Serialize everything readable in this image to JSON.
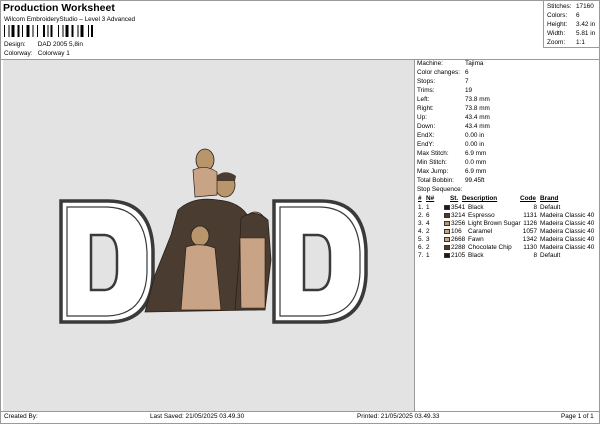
{
  "header": {
    "title": "Production Worksheet",
    "software": "Wilcom EmbroideryStudio – Level 3 Advanced",
    "design_label": "Design:",
    "design_value": "DAD 2005 5,8in",
    "colorway_label": "Colorway:",
    "colorway_value": "Colorway 1"
  },
  "stats": [
    {
      "label": "Stitches:",
      "value": "17160"
    },
    {
      "label": "Colors:",
      "value": "6"
    },
    {
      "label": "Height:",
      "value": "3.42 in"
    },
    {
      "label": "Width:",
      "value": "5.81 in"
    },
    {
      "label": "Zoom:",
      "value": "1:1"
    }
  ],
  "machine_info": [
    {
      "label": "Machine:",
      "value": "Tajima"
    },
    {
      "label": "Color changes:",
      "value": "6"
    },
    {
      "label": "Stops:",
      "value": "7"
    },
    {
      "label": "Trims:",
      "value": "19"
    },
    {
      "label": "Left:",
      "value": "73.8 mm"
    },
    {
      "label": "Right:",
      "value": "73.8 mm"
    },
    {
      "label": "Up:",
      "value": "43.4 mm"
    },
    {
      "label": "Down:",
      "value": "43.4 mm"
    },
    {
      "label": "EndX:",
      "value": "0.00 in"
    },
    {
      "label": "EndY:",
      "value": "0.00 in"
    },
    {
      "label": "Max Stitch:",
      "value": "6.9 mm"
    },
    {
      "label": "Min Stitch:",
      "value": "0.0 mm"
    },
    {
      "label": "Max Jump:",
      "value": "6.9 mm"
    },
    {
      "label": "Total Bobbin:",
      "value": "99.45ft"
    }
  ],
  "stop_sequence": {
    "heading": "Stop Sequence:",
    "columns": [
      "#",
      "N#",
      "St.",
      "Description",
      "Code",
      "Brand"
    ],
    "rows": [
      {
        "num": "1.",
        "needle": "1",
        "color": "#1a1a1a",
        "stitches": "3541",
        "description": "Black",
        "code": "8",
        "brand": "Default"
      },
      {
        "num": "2.",
        "needle": "6",
        "color": "#4a3a2e",
        "stitches": "3214",
        "description": "Espresso",
        "code": "1131",
        "brand": "Madeira Classic 40"
      },
      {
        "num": "3.",
        "needle": "4",
        "color": "#b8956a",
        "stitches": "3256",
        "description": "Light Brown Sugar",
        "code": "1126",
        "brand": "Madeira Classic 40"
      },
      {
        "num": "4.",
        "needle": "2",
        "color": "#c8a47a",
        "stitches": "106",
        "description": "Caramel",
        "code": "1057",
        "brand": "Madeira Classic 40"
      },
      {
        "num": "5.",
        "needle": "3",
        "color": "#c9a386",
        "stitches": "2668",
        "description": "Fawn",
        "code": "1342",
        "brand": "Madeira Classic 40"
      },
      {
        "num": "6.",
        "needle": "2",
        "color": "#4a3c30",
        "stitches": "2288",
        "description": "Chocolate Chip",
        "code": "1130",
        "brand": "Madeira Classic 40"
      },
      {
        "num": "7.",
        "needle": "1",
        "color": "#1a1a1a",
        "stitches": "2105",
        "description": "Black",
        "code": "8",
        "brand": "Default"
      }
    ]
  },
  "footer": {
    "created_by": "Created By:",
    "last_saved": "Last Saved: 21/05/2025 03.49.30",
    "printed": "Printed: 21/05/2025 03.49.33",
    "page": "Page 1 of 1"
  },
  "colors": {
    "canvas_bg": "#e3e3e3",
    "letter_fill": "#ffffff",
    "letter_outline": "#3a3a3a",
    "skin": "#b8956a",
    "dark": "#4a3c30",
    "light": "#c9a386"
  }
}
